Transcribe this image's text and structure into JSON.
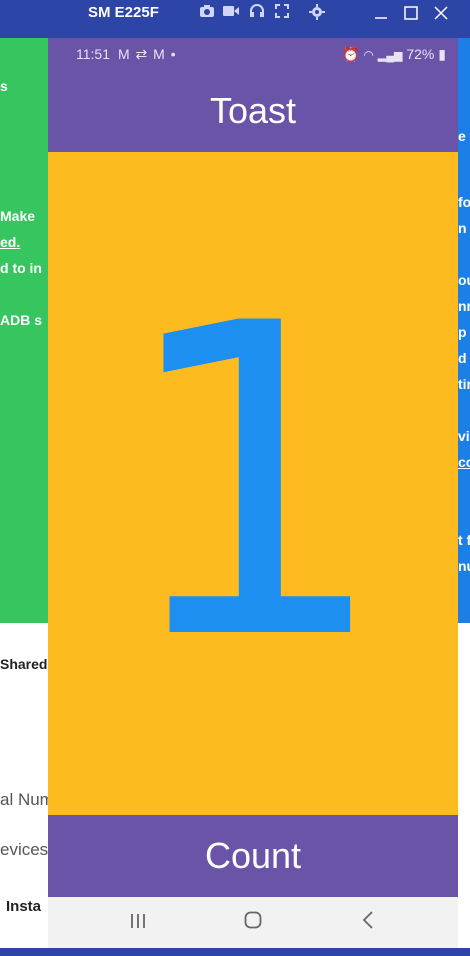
{
  "window": {
    "title": "SM E225F",
    "icons": [
      "camera-icon",
      "video-icon",
      "headphones-icon",
      "fullscreen-icon",
      "settings-icon"
    ],
    "controls": [
      "minimize",
      "maximize",
      "close"
    ]
  },
  "status_bar": {
    "time": "11:51",
    "notification_icons": "M ⇄ M •",
    "battery": "72%"
  },
  "app": {
    "toast_button": "Toast",
    "count_value": "1",
    "count_button": "Count"
  },
  "colors": {
    "primary": "#6a54a8",
    "count_bg": "#fdbb1f",
    "count_text": "#1c8ff0"
  },
  "background_snippets": {
    "left": [
      "s",
      "Make",
      "ed.",
      "d to in",
      "ADB s",
      "Shared"
    ],
    "left_lower": [
      "al Num",
      "evices",
      "Insta"
    ],
    "right": [
      "e",
      "fo",
      "n",
      "ou",
      "nn",
      "p",
      "d",
      "tin",
      "vi",
      "cc",
      "t f",
      "nu"
    ]
  }
}
